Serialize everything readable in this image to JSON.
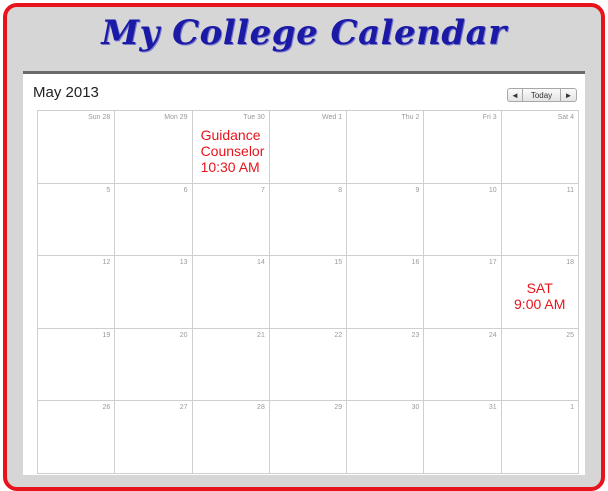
{
  "banner": {
    "title": "My College Calendar"
  },
  "calendar": {
    "month_title": "May 2013",
    "nav": {
      "prev": "◄",
      "today": "Today",
      "next": "►"
    },
    "weeks": [
      [
        "Sun 28",
        "Mon 29",
        "Tue 30",
        "Wed 1",
        "Thu 2",
        "Fri 3",
        "Sat 4"
      ],
      [
        "5",
        "6",
        "7",
        "8",
        "9",
        "10",
        "11"
      ],
      [
        "12",
        "13",
        "14",
        "15",
        "16",
        "17",
        "18"
      ],
      [
        "19",
        "20",
        "21",
        "22",
        "23",
        "24",
        "25"
      ],
      [
        "26",
        "27",
        "28",
        "29",
        "30",
        "31",
        "1"
      ]
    ],
    "events": {
      "guidance": {
        "line1": "Guidance",
        "line2": "Counselor",
        "line3": "10:30 AM"
      },
      "sat": {
        "line1": "SAT",
        "line2": "9:00 AM"
      }
    }
  },
  "colors": {
    "frame": "#e8141c",
    "title": "#1a1aa6",
    "event": "#e8141c"
  }
}
